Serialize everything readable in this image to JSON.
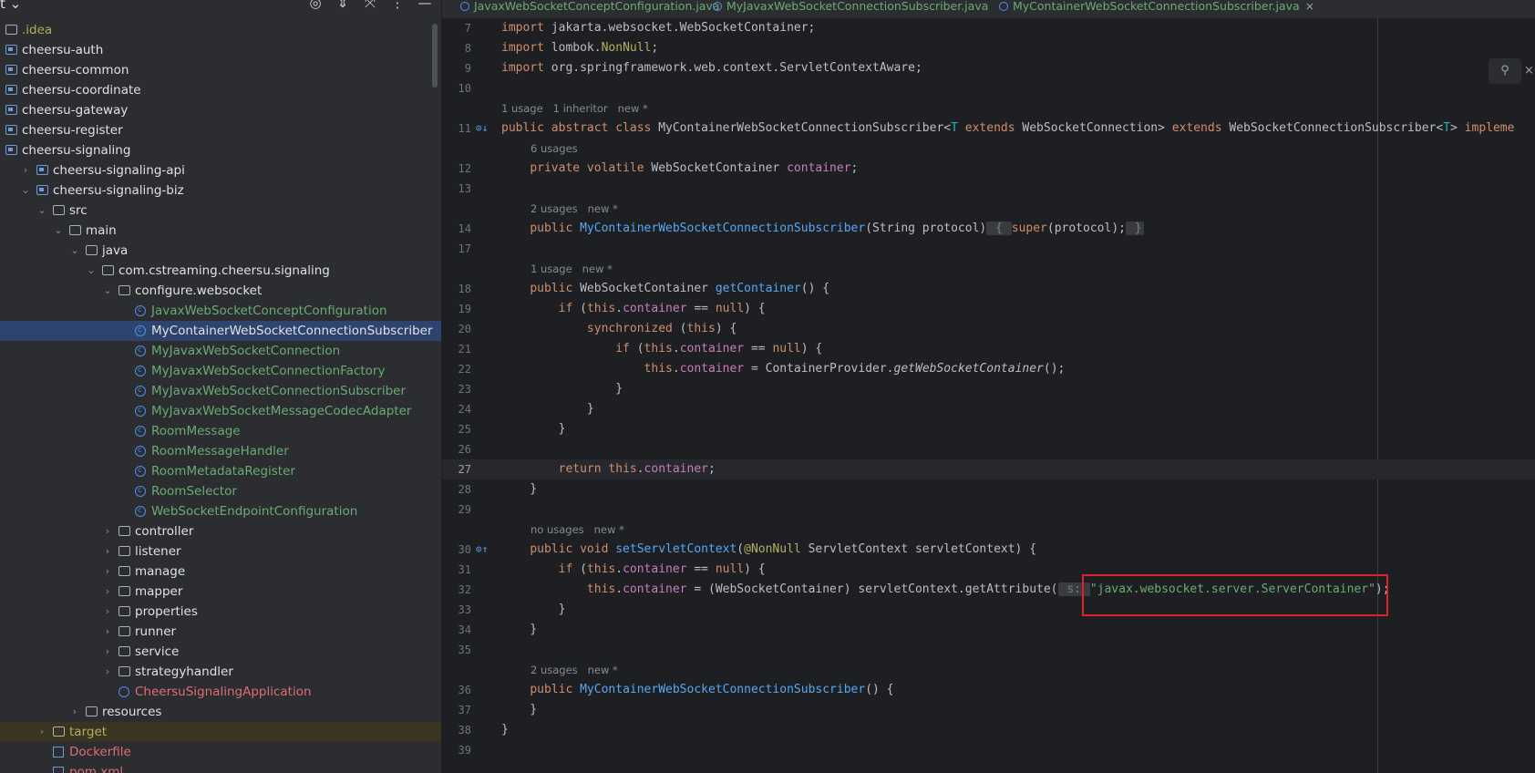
{
  "project_panel": {
    "title": "t",
    "tools": [
      {
        "name": "locate-icon",
        "glyph": "◎"
      },
      {
        "name": "expand-all-icon",
        "glyph": "⇕"
      },
      {
        "name": "collapse-all-icon",
        "glyph": "⤧"
      },
      {
        "name": "more-icon",
        "glyph": "⋮"
      },
      {
        "name": "minimize-icon",
        "glyph": "—"
      }
    ],
    "tree": [
      {
        "label": ".idea",
        "indent": 0,
        "icon": "folder",
        "color": "olive",
        "chev": ""
      },
      {
        "label": "cheersu-auth",
        "indent": 0,
        "icon": "module",
        "color": "white",
        "chev": ""
      },
      {
        "label": "cheersu-common",
        "indent": 0,
        "icon": "module",
        "color": "white",
        "chev": ""
      },
      {
        "label": "cheersu-coordinate",
        "indent": 0,
        "icon": "module",
        "color": "white",
        "chev": ""
      },
      {
        "label": "cheersu-gateway",
        "indent": 0,
        "icon": "module",
        "color": "white",
        "chev": ""
      },
      {
        "label": "cheersu-register",
        "indent": 0,
        "icon": "module",
        "color": "white",
        "chev": ""
      },
      {
        "label": "cheersu-signaling",
        "indent": 0,
        "icon": "module",
        "color": "white",
        "chev": ""
      },
      {
        "label": "cheersu-signaling-api",
        "indent": 1,
        "icon": "module",
        "color": "white",
        "chev": "›"
      },
      {
        "label": "cheersu-signaling-biz",
        "indent": 1,
        "icon": "module",
        "color": "white",
        "chev": "⌄"
      },
      {
        "label": "src",
        "indent": 2,
        "icon": "folder",
        "color": "white",
        "chev": "⌄"
      },
      {
        "label": "main",
        "indent": 3,
        "icon": "folder",
        "color": "white",
        "chev": "⌄"
      },
      {
        "label": "java",
        "indent": 4,
        "icon": "folder",
        "color": "white",
        "chev": "⌄"
      },
      {
        "label": "com.cstreaming.cheersu.signaling",
        "indent": 5,
        "icon": "folder",
        "color": "white",
        "chev": "⌄"
      },
      {
        "label": "configure.websocket",
        "indent": 6,
        "icon": "folder",
        "color": "white",
        "chev": "⌄"
      },
      {
        "label": "JavaxWebSocketConceptConfiguration",
        "indent": 7,
        "icon": "class",
        "color": "green",
        "chev": ""
      },
      {
        "label": "MyContainerWebSocketConnectionSubscriber",
        "indent": 7,
        "icon": "class",
        "color": "white",
        "chev": "",
        "selected": true
      },
      {
        "label": "MyJavaxWebSocketConnection",
        "indent": 7,
        "icon": "class",
        "color": "green",
        "chev": ""
      },
      {
        "label": "MyJavaxWebSocketConnectionFactory",
        "indent": 7,
        "icon": "class",
        "color": "green",
        "chev": ""
      },
      {
        "label": "MyJavaxWebSocketConnectionSubscriber",
        "indent": 7,
        "icon": "class",
        "color": "green",
        "chev": ""
      },
      {
        "label": "MyJavaxWebSocketMessageCodecAdapter",
        "indent": 7,
        "icon": "class",
        "color": "green",
        "chev": ""
      },
      {
        "label": "RoomMessage",
        "indent": 7,
        "icon": "class",
        "color": "green",
        "chev": ""
      },
      {
        "label": "RoomMessageHandler",
        "indent": 7,
        "icon": "class",
        "color": "green",
        "chev": ""
      },
      {
        "label": "RoomMetadataRegister",
        "indent": 7,
        "icon": "class",
        "color": "green",
        "chev": ""
      },
      {
        "label": "RoomSelector",
        "indent": 7,
        "icon": "class",
        "color": "green",
        "chev": ""
      },
      {
        "label": "WebSocketEndpointConfiguration",
        "indent": 7,
        "icon": "class",
        "color": "green",
        "chev": ""
      },
      {
        "label": "controller",
        "indent": 6,
        "icon": "folder",
        "color": "white",
        "chev": "›"
      },
      {
        "label": "listener",
        "indent": 6,
        "icon": "folder",
        "color": "white",
        "chev": "›"
      },
      {
        "label": "manage",
        "indent": 6,
        "icon": "folder",
        "color": "white",
        "chev": "›"
      },
      {
        "label": "mapper",
        "indent": 6,
        "icon": "folder",
        "color": "white",
        "chev": "›"
      },
      {
        "label": "properties",
        "indent": 6,
        "icon": "folder",
        "color": "white",
        "chev": "›"
      },
      {
        "label": "runner",
        "indent": 6,
        "icon": "folder",
        "color": "white",
        "chev": "›"
      },
      {
        "label": "service",
        "indent": 6,
        "icon": "folder",
        "color": "white",
        "chev": "›"
      },
      {
        "label": "strategyhandler",
        "indent": 6,
        "icon": "folder",
        "color": "white",
        "chev": "›"
      },
      {
        "label": "CheersuSignalingApplication",
        "indent": 6,
        "icon": "app",
        "color": "red",
        "chev": ""
      },
      {
        "label": "resources",
        "indent": 4,
        "icon": "folder",
        "color": "white",
        "chev": "›"
      },
      {
        "label": "target",
        "indent": 2,
        "icon": "folder",
        "color": "olive",
        "chev": "›",
        "target": true
      },
      {
        "label": "Dockerfile",
        "indent": 2,
        "icon": "file",
        "color": "red",
        "chev": ""
      },
      {
        "label": "pom.xml",
        "indent": 2,
        "icon": "file",
        "color": "red",
        "chev": ""
      }
    ]
  },
  "tabs": [
    {
      "label": "JavaxWebSocketConceptConfiguration.java",
      "active": false
    },
    {
      "label": "MyJavaxWebSocketConnectionSubscriber.java",
      "active": false
    },
    {
      "label": "MyContainerWebSocketConnectionSubscriber.java",
      "active": true,
      "close": "×"
    }
  ],
  "editor": {
    "lines": [
      {
        "n": "7",
        "html": "<span class='k'>import</span> jakarta.websocket.WebSocketContainer;"
      },
      {
        "n": "8",
        "html": "<span class='k'>import</span> lombok.<span class='a'>NonNull</span>;"
      },
      {
        "n": "9",
        "html": "<span class='k'>import</span> org.springframework.web.context.ServletContextAware;"
      },
      {
        "n": "10",
        "html": ""
      },
      {
        "n": "",
        "hint": "1 usage   1 inheritor   new *",
        "indent": 0
      },
      {
        "n": "11",
        "gutter": "⊙↓",
        "html": "<span class='k'>public abstract class</span> MyContainerWebSocketConnectionSubscriber&lt;<span class='tp'>T</span> <span class='k'>extends</span> WebSocketConnection&gt; <span class='k'>extends</span> WebSocketConnectionSubscriber&lt;<span class='tp'>T</span>&gt; <span class='k'>impleme</span>"
      },
      {
        "n": "",
        "hint": "6 usages",
        "indent": 1
      },
      {
        "n": "12",
        "html": "    <span class='k'>private volatile</span> WebSocketContainer <span class='f'>container</span>;"
      },
      {
        "n": "13",
        "html": ""
      },
      {
        "n": "",
        "hint": "2 usages   new *",
        "indent": 1
      },
      {
        "n": "14",
        "html": "    <span class='k'>public</span> <span class='m'>MyContainerWebSocketConnectionSubscriber</span>(String protocol)<span class='fold'> { </span><span class='k'>super</span>(protocol);<span class='fold'> }</span>"
      },
      {
        "n": "17",
        "html": ""
      },
      {
        "n": "",
        "hint": "1 usage   new *",
        "indent": 1
      },
      {
        "n": "18",
        "html": "    <span class='k'>public</span> WebSocketContainer <span class='m'>getContainer</span>() {"
      },
      {
        "n": "19",
        "html": "        <span class='k'>if</span> (<span class='k'>this</span>.<span class='f'>container</span> == <span class='k'>null</span>) {"
      },
      {
        "n": "20",
        "html": "            <span class='k'>synchronized</span> (<span class='k'>this</span>) {"
      },
      {
        "n": "21",
        "html": "                <span class='k'>if</span> (<span class='k'>this</span>.<span class='f'>container</span> == <span class='k'>null</span>) {"
      },
      {
        "n": "22",
        "html": "                    <span class='k'>this</span>.<span class='f'>container</span> = ContainerProvider.<span class='it'>getWebSocketContainer</span>();"
      },
      {
        "n": "23",
        "html": "                }"
      },
      {
        "n": "24",
        "html": "            }"
      },
      {
        "n": "25",
        "html": "        }"
      },
      {
        "n": "26",
        "html": ""
      },
      {
        "n": "27",
        "cur": true,
        "html": "        <span class='k'>return this</span>.<span class='f'>container</span>;"
      },
      {
        "n": "28",
        "html": "    }"
      },
      {
        "n": "29",
        "html": ""
      },
      {
        "n": "",
        "hint": "no usages   new *",
        "indent": 1
      },
      {
        "n": "30",
        "gutter": "⊙↑",
        "html": "    <span class='k'>public void</span> <span class='m'>setServletContext</span>(<span class='a'>@NonNull</span> ServletContext servletContext) {"
      },
      {
        "n": "31",
        "html": "        <span class='k'>if</span> (<span class='k'>this</span>.<span class='f'>container</span> == <span class='k'>null</span>) {"
      },
      {
        "n": "32",
        "html": "            <span class='k'>this</span>.<span class='f'>container</span> = (WebSocketContainer) servletContext.getAttribute(<span class='fold'> s: </span><span class='s'>\"javax.websocket.server.ServerContainer\"</span>);"
      },
      {
        "n": "33",
        "html": "        }"
      },
      {
        "n": "34",
        "html": "    }"
      },
      {
        "n": "35",
        "html": ""
      },
      {
        "n": "",
        "hint": "2 usages   new *",
        "indent": 1
      },
      {
        "n": "36",
        "html": "    <span class='k'>public</span> <span class='m'>MyContainerWebSocketConnectionSubscriber</span>() {"
      },
      {
        "n": "37",
        "html": "    }"
      },
      {
        "n": "38",
        "html": "}"
      },
      {
        "n": "39",
        "html": ""
      }
    ]
  },
  "float_toolbar": {
    "icon": "reader-mode-icon",
    "glyph": "⚲",
    "close": "×"
  }
}
